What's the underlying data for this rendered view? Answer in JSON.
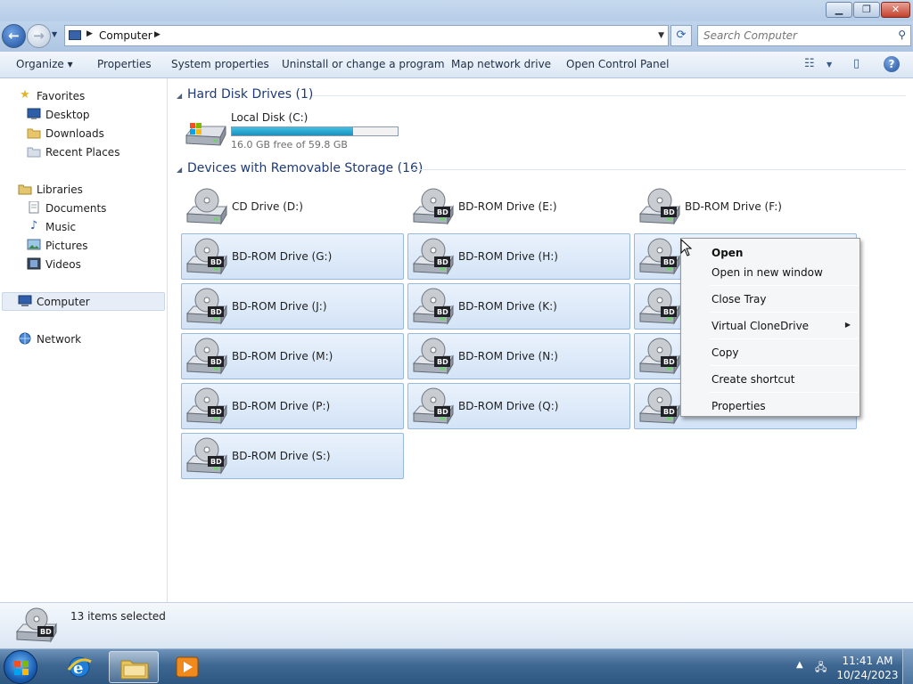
{
  "window": {
    "min_glyph": "▁",
    "max_glyph": "❐",
    "close_glyph": "✕"
  },
  "address": {
    "back_glyph": "←",
    "forward_glyph": "→",
    "crumb": "Computer",
    "crumb_sep": "▶",
    "search_placeholder": "Search Computer"
  },
  "toolbar": {
    "items": [
      "Organize ▾",
      "Properties",
      "System properties",
      "Uninstall or change a program",
      "Map network drive",
      "Open Control Panel"
    ],
    "help_glyph": "?"
  },
  "nav": {
    "favorites": "Favorites",
    "desktop": "Desktop",
    "downloads": "Downloads",
    "recent": "Recent Places",
    "libraries": "Libraries",
    "documents": "Documents",
    "music": "Music",
    "pictures": "Pictures",
    "videos": "Videos",
    "computer": "Computer",
    "network": "Network"
  },
  "groups": {
    "hdd_title": "Hard Disk Drives (1)",
    "removable_title": "Devices with Removable Storage (16)"
  },
  "local_disk": {
    "name": "Local Disk (C:)",
    "free_text": "16.0 GB free of 59.8 GB",
    "used_fraction": 0.732
  },
  "drives": [
    {
      "name": "CD Drive (D:)",
      "selected": false,
      "kind": "cd"
    },
    {
      "name": "BD-ROM Drive (E:)",
      "selected": false,
      "kind": "bd"
    },
    {
      "name": "BD-ROM Drive (F:)",
      "selected": false,
      "kind": "bd"
    },
    {
      "name": "BD-ROM Drive (G:)",
      "selected": true,
      "kind": "bd"
    },
    {
      "name": "BD-ROM Drive (H:)",
      "selected": true,
      "kind": "bd"
    },
    {
      "name": "",
      "selected": true,
      "kind": "bd"
    },
    {
      "name": "BD-ROM Drive (J:)",
      "selected": true,
      "kind": "bd"
    },
    {
      "name": "BD-ROM Drive (K:)",
      "selected": true,
      "kind": "bd"
    },
    {
      "name": "",
      "selected": true,
      "kind": "bd"
    },
    {
      "name": "BD-ROM Drive (M:)",
      "selected": true,
      "kind": "bd"
    },
    {
      "name": "BD-ROM Drive (N:)",
      "selected": true,
      "kind": "bd"
    },
    {
      "name": "",
      "selected": true,
      "kind": "bd"
    },
    {
      "name": "BD-ROM Drive (P:)",
      "selected": true,
      "kind": "bd"
    },
    {
      "name": "BD-ROM Drive (Q:)",
      "selected": true,
      "kind": "bd"
    },
    {
      "name": "",
      "selected": true,
      "kind": "bd"
    },
    {
      "name": "BD-ROM Drive (S:)",
      "selected": true,
      "kind": "bd"
    }
  ],
  "context_menu": {
    "open": "Open",
    "open_new": "Open in new window",
    "close_tray": "Close Tray",
    "virtual_clonedrive": "Virtual CloneDrive",
    "copy": "Copy",
    "create_shortcut": "Create shortcut",
    "properties": "Properties",
    "submenu_arrow": "▶"
  },
  "status": {
    "selected_text": "13 items selected"
  },
  "taskbar": {
    "time": "11:41 AM",
    "date": "10/24/2023"
  },
  "colors": {
    "accent": "#1e3a78",
    "selection": "#d3e3f6",
    "disk_fill": "#1b8fbd"
  },
  "icons": [
    "back-arrow-icon",
    "forward-arrow-icon",
    "computer-icon",
    "refresh-icon",
    "search-icon",
    "view-options-icon",
    "preview-pane-icon",
    "help-icon",
    "star-icon",
    "folder-icon",
    "library-icon",
    "network-icon",
    "hard-disk-icon",
    "bd-drive-icon",
    "cd-drive-icon",
    "windows-start-icon",
    "internet-explorer-icon",
    "explorer-folder-icon",
    "media-player-icon",
    "flag-icon",
    "network-tray-icon"
  ]
}
